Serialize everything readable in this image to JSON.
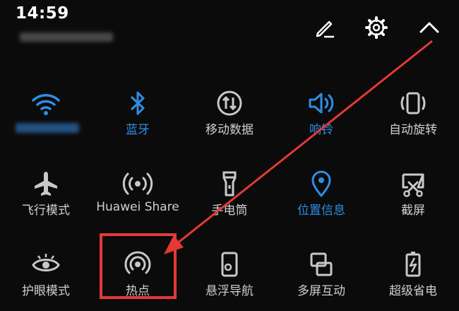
{
  "status_bar": {
    "time": "14:59"
  },
  "header": {
    "edit_icon": "pencil-icon",
    "settings_icon": "gear-icon",
    "collapse_icon": "chevron-up-icon"
  },
  "tiles": [
    {
      "label": "",
      "icon": "wifi-icon",
      "active": true
    },
    {
      "label": "蓝牙",
      "icon": "bluetooth-icon",
      "active": true
    },
    {
      "label": "移动数据",
      "icon": "mobile-data-icon",
      "active": false
    },
    {
      "label": "响铃",
      "icon": "speaker-icon",
      "active": true
    },
    {
      "label": "自动旋转",
      "icon": "auto-rotate-icon",
      "active": false
    },
    {
      "label": "飞行模式",
      "icon": "airplane-icon",
      "active": false
    },
    {
      "label": "Huawei Share",
      "icon": "huawei-share-icon",
      "active": false
    },
    {
      "label": "手电筒",
      "icon": "flashlight-icon",
      "active": false
    },
    {
      "label": "位置信息",
      "icon": "location-icon",
      "active": true
    },
    {
      "label": "截屏",
      "icon": "screenshot-icon",
      "active": false
    },
    {
      "label": "护眼模式",
      "icon": "eye-comfort-icon",
      "active": false
    },
    {
      "label": "热点",
      "icon": "hotspot-icon",
      "active": false
    },
    {
      "label": "悬浮导航",
      "icon": "floating-nav-icon",
      "active": false
    },
    {
      "label": "多屏互动",
      "icon": "multi-screen-icon",
      "active": false
    },
    {
      "label": "超级省电",
      "icon": "battery-saver-icon",
      "active": false
    }
  ],
  "colors": {
    "active": "#2e8ee5",
    "inactive": "#c8c8c8",
    "annotation": "#e53935",
    "background": "#0b0b0b"
  }
}
